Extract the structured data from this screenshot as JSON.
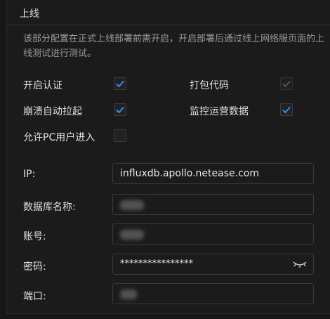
{
  "section": {
    "title": "上线",
    "description": "该部分配置在正式上线部署前需开启，开启部署后通过线上网络服页面的上线测试进行测试。"
  },
  "options": {
    "enable_auth": {
      "label": "开启认证",
      "checked": true
    },
    "pack_code": {
      "label": "打包代码",
      "checked": true,
      "disabled": true
    },
    "crash_restart": {
      "label": "崩溃自动拉起",
      "checked": true
    },
    "monitor_ops": {
      "label": "监控运营数据",
      "checked": true
    },
    "allow_pc": {
      "label": "允许PC用户进入",
      "checked": false
    }
  },
  "fields": {
    "ip": {
      "label": "IP:",
      "value": "influxdb.apollo.netease.com"
    },
    "db_name": {
      "label": "数据库名称:",
      "value": ""
    },
    "account": {
      "label": "账号:",
      "value": ""
    },
    "password": {
      "label": "密码:",
      "value": "****************"
    },
    "port": {
      "label": "端口:",
      "value": ""
    }
  },
  "colors": {
    "check_accent": "#2f8ff0",
    "check_disabled": "#4a5866"
  },
  "icons": {
    "checkmark": "check-icon",
    "password_toggle": "eye-closed-icon"
  }
}
